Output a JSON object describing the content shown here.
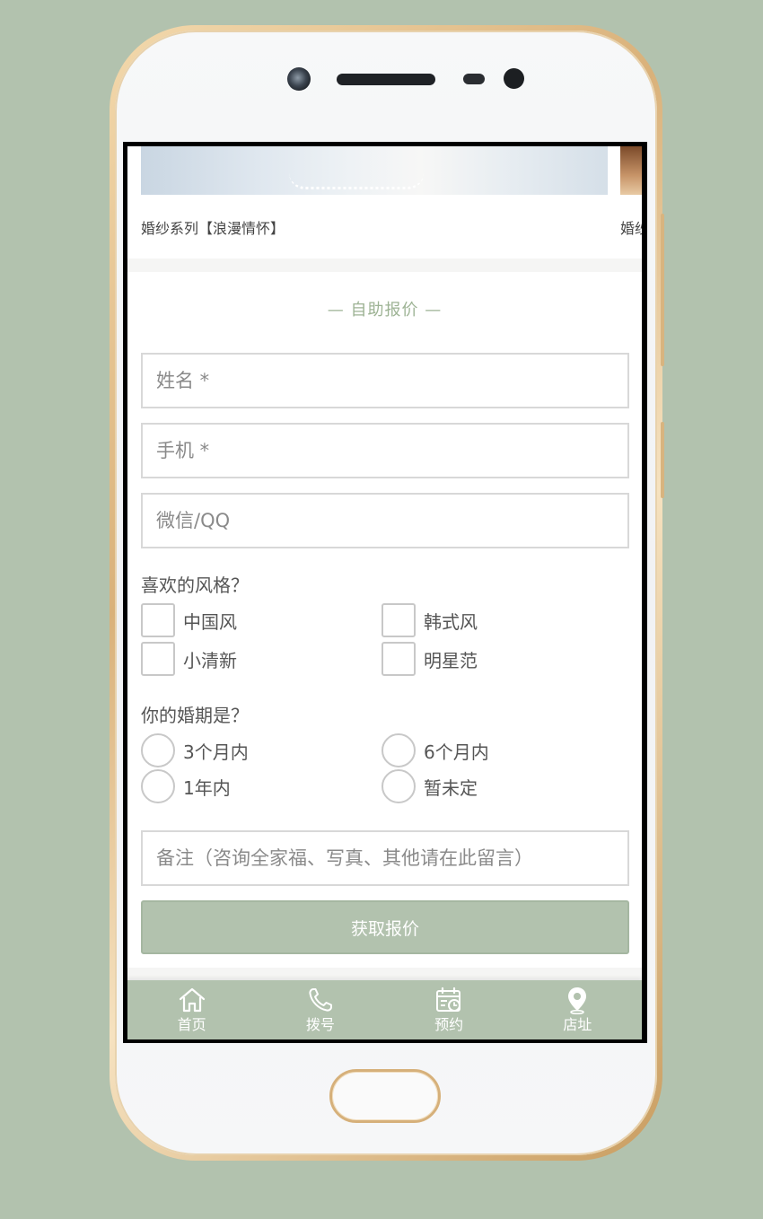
{
  "gallery": {
    "items": [
      {
        "caption": "婚纱系列【浪漫情怀】"
      },
      {
        "caption": "婚纱"
      }
    ]
  },
  "form": {
    "title": "— 自助报价 —",
    "fields": {
      "name_placeholder": "姓名 *",
      "phone_placeholder": "手机 *",
      "wechat_placeholder": "微信/QQ",
      "notes_placeholder": "备注（咨询全家福、写真、其他请在此留言）"
    },
    "style_question": {
      "label": "喜欢的风格？",
      "options": [
        "中国风",
        "韩式风",
        "小清新",
        "明星范"
      ]
    },
    "date_question": {
      "label": "你的婚期是？",
      "options": [
        "3个月内",
        "6个月内",
        "1年内",
        "暂未定"
      ]
    },
    "submit_label": "获取报价"
  },
  "tabbar": {
    "items": [
      {
        "label": "首页",
        "icon": "home-icon"
      },
      {
        "label": "拨号",
        "icon": "phone-icon"
      },
      {
        "label": "预约",
        "icon": "calendar-icon"
      },
      {
        "label": "店址",
        "icon": "location-pin-icon"
      }
    ]
  },
  "colors": {
    "page_background": "#b2c2ae",
    "accent": "#9db394",
    "button": "#b2c2ae",
    "phone_trim": "#d8b47f"
  }
}
